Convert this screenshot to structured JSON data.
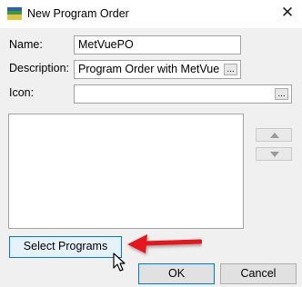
{
  "window": {
    "title": "New Program Order",
    "close_glyph": "✕",
    "title_icon": "app-icon"
  },
  "form": {
    "name_label": "Name:",
    "name_value": "MetVuePO",
    "description_label": "Description:",
    "description_value": "Program Order with MetVue",
    "icon_label": "Icon:",
    "icon_value": "",
    "browse_glyph": "..."
  },
  "programs": {
    "items": [],
    "move_up_icon": "triangle-up-icon",
    "move_down_icon": "triangle-down-icon"
  },
  "buttons": {
    "select_programs": "Select Programs",
    "ok": "OK",
    "cancel": "Cancel"
  },
  "annotation": {
    "arrow_color": "#e8121a",
    "focus_color": "#0078d7"
  }
}
